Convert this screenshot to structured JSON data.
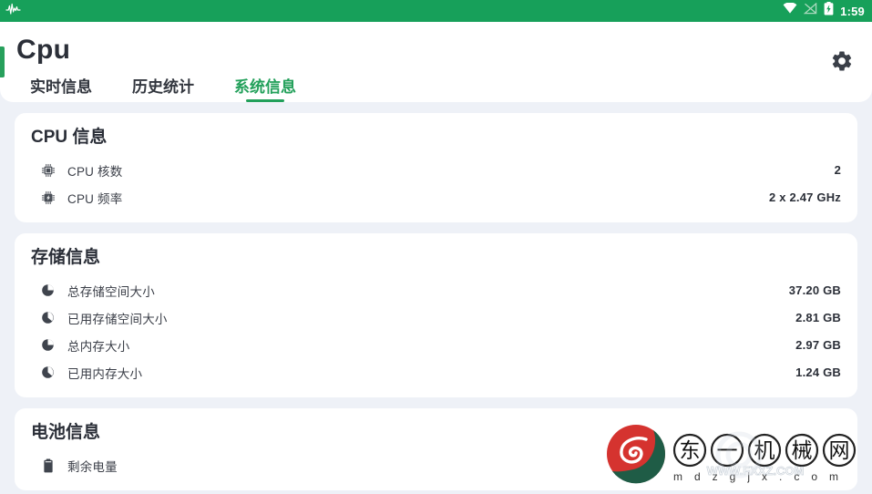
{
  "statusbar": {
    "notification_icon": "pulse-waveform-icon",
    "wifi_icon": "wifi-icon",
    "signal_icon": "signal-off-icon",
    "battery_icon": "battery-charging-icon",
    "clock": "1:59"
  },
  "appbar": {
    "title": "Cpu",
    "settings_icon": "gear-icon",
    "accent_color": "#27a05c"
  },
  "tabs": [
    {
      "label": "实时信息",
      "active": false
    },
    {
      "label": "历史统计",
      "active": false
    },
    {
      "label": "系统信息",
      "active": true
    }
  ],
  "cards": [
    {
      "title": "CPU 信息",
      "rows": [
        {
          "icon": "cpu-chip-icon",
          "label": "CPU 核数",
          "value": "2"
        },
        {
          "icon": "cpu-speed-icon",
          "label": "CPU 频率",
          "value": "2 x 2.47 GHz"
        }
      ]
    },
    {
      "title": "存储信息",
      "rows": [
        {
          "icon": "pie-chart-icon",
          "label": "总存储空间大小",
          "value": "37.20 GB"
        },
        {
          "icon": "pie-chart-icon",
          "label": "已用存储空间大小",
          "value": "2.81 GB"
        },
        {
          "icon": "pie-chart-icon",
          "label": "总内存大小",
          "value": "2.97 GB"
        },
        {
          "icon": "pie-chart-icon",
          "label": "已用内存大小",
          "value": "1.24 GB"
        }
      ]
    },
    {
      "title": "电池信息",
      "rows": [
        {
          "icon": "battery-icon",
          "label": "剩余电量",
          "value": ""
        }
      ]
    }
  ],
  "watermark": {
    "brand_text": "东一机械网",
    "brand_chars": [
      "东",
      "一",
      "机",
      "械",
      "网"
    ],
    "domain_text": "mdzgjx.com",
    "domain_chars": [
      "m",
      "d",
      "z",
      "g",
      "j",
      "x",
      ".",
      "c",
      "o",
      "m"
    ],
    "overlay_text": "WWW.FXXZ.COM",
    "logo_colors": {
      "red": "#d5332f",
      "green": "#1f5c46"
    }
  },
  "colors": {
    "brand_green": "#17a05a",
    "tab_active": "#22a05a",
    "page_bg": "#eef1f7",
    "card_bg": "#ffffff",
    "title_highlight": "#d7dbe3",
    "text_primary": "#2b2f38"
  }
}
